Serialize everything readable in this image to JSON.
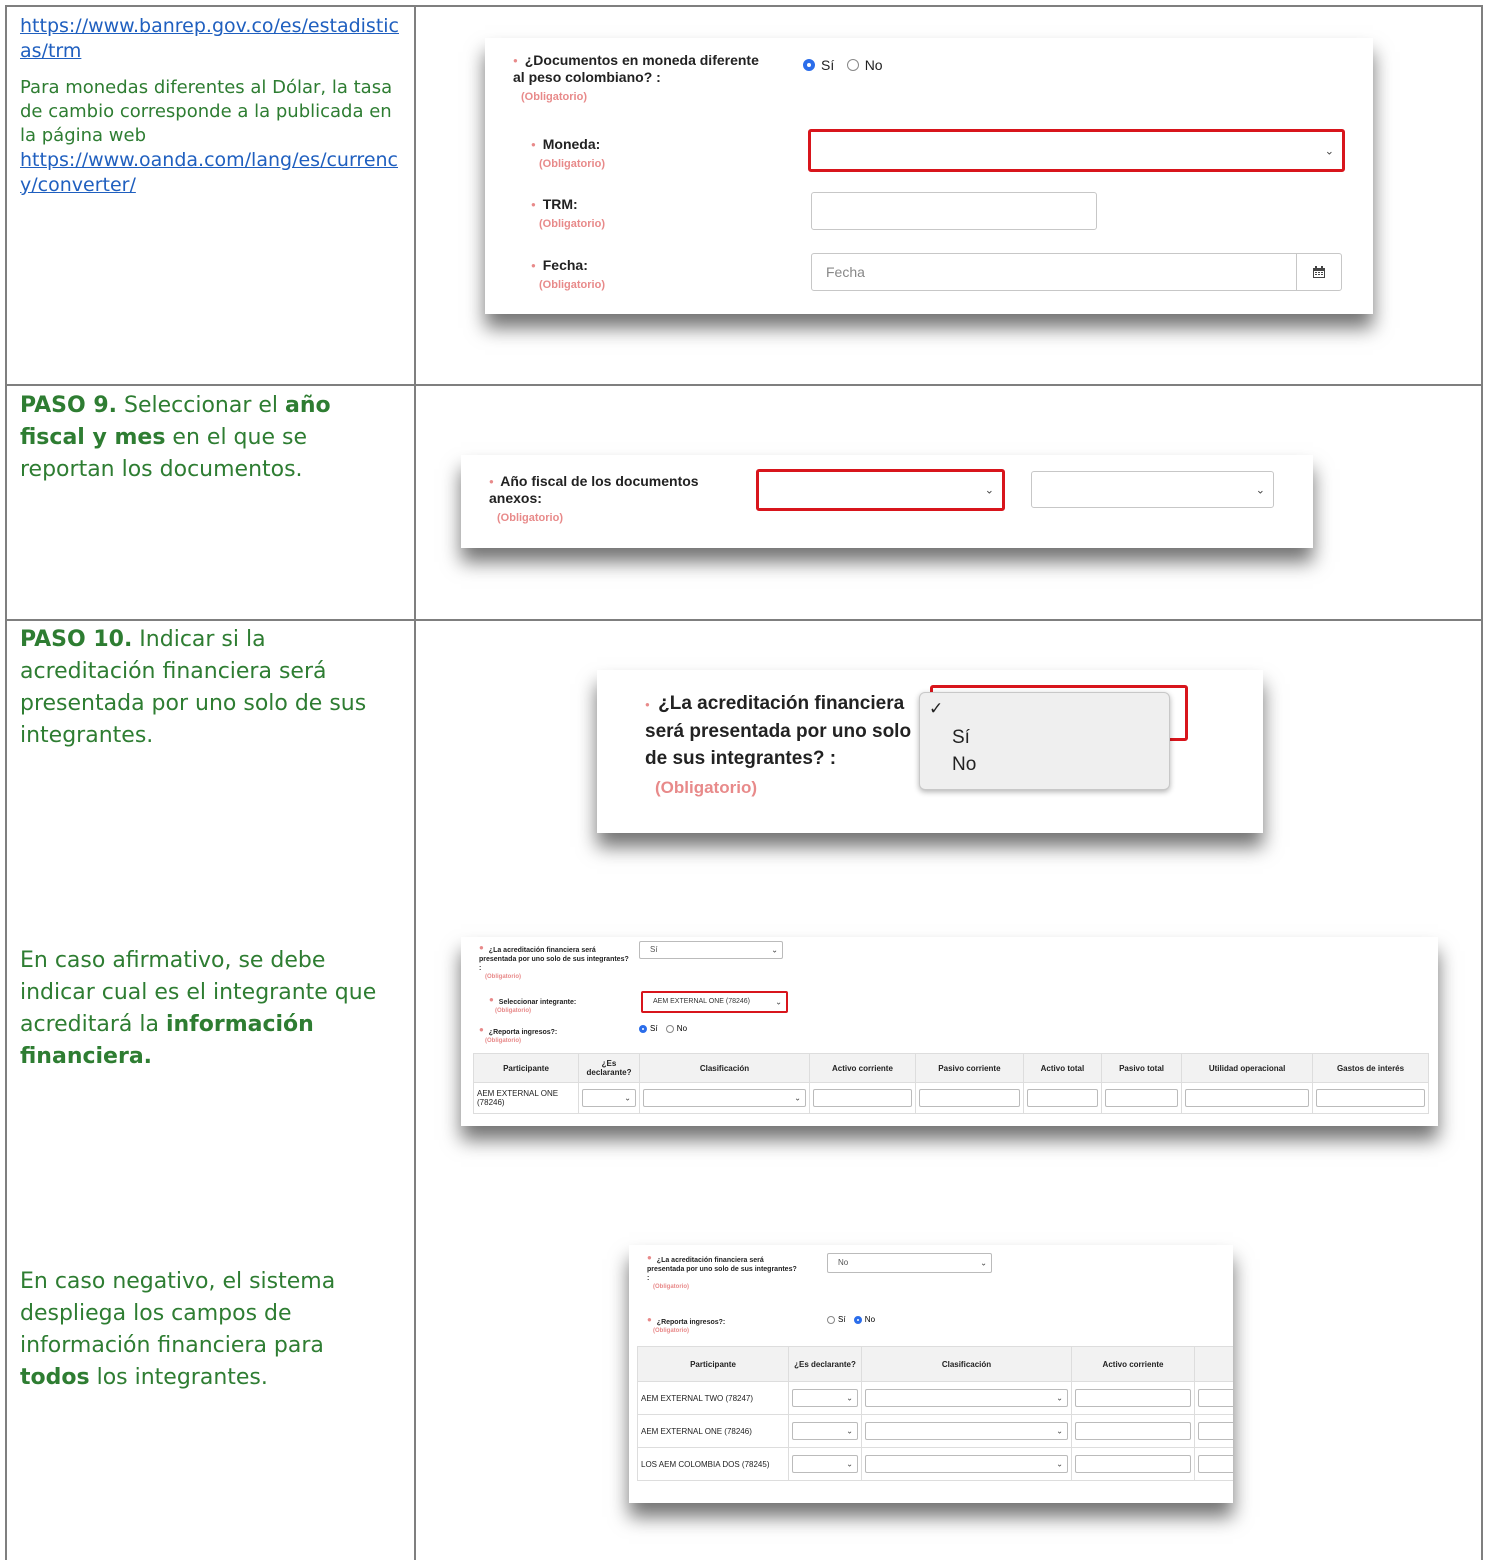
{
  "row1": {
    "link1": "https://www.banrep.gov.co/es/estadisticas/trm",
    "text": "Para monedas diferentes al Dólar, la tasa de cambio corresponde a la publicada en la página web",
    "link2": "https://www.oanda.com/lang/es/currency/converter/",
    "form": {
      "q_docs": "¿Documentos en moneda diferente al peso colombiano? :",
      "required": "(Obligatorio)",
      "opt_si": "Sí",
      "opt_no": "No",
      "moneda": "Moneda:",
      "trm": "TRM:",
      "fecha": "Fecha:",
      "fecha_placeholder": "Fecha"
    }
  },
  "row2": {
    "step": "PASO 9.",
    "t1": " Seleccionar el ",
    "b1": "año fiscal y mes",
    "t2": " en el que se reportan los documentos.",
    "form": {
      "label": "Año fiscal de los documentos anexos:",
      "required": "(Obligatorio)"
    }
  },
  "row3": {
    "step": "PASO 10.",
    "t1": " Indicar si la acreditación financiera será presentada por uno solo de sus integrantes.",
    "dropdown": {
      "label": "¿La acreditación financiera será presentada por uno solo de sus integrantes? :",
      "required": "(Obligatorio)",
      "check": "✓",
      "opt1": "Sí",
      "opt2": "No"
    },
    "affirm_text": "En caso afirmativo, se debe indicar cual es el integrante que acreditará la ",
    "affirm_bold": "información financiera.",
    "affirm_form": {
      "q": "¿La acreditación financiera será presentada por uno solo de sus integrantes? :",
      "required": "(Obligatorio)",
      "value": "Sí",
      "select_label": "Seleccionar integrante:",
      "select_value": "AEM EXTERNAL ONE (78246)",
      "ingresos": "¿Reporta ingresos?:",
      "si": "Sí",
      "no": "No",
      "headers": [
        "Participante",
        "¿Es declarante?",
        "Clasificación",
        "Activo corriente",
        "Pasivo corriente",
        "Activo total",
        "Pasivo total",
        "Utilidad operacional",
        "Gastos de interés"
      ],
      "rows": [
        "AEM EXTERNAL ONE (78246)"
      ]
    },
    "neg_text1": "En caso negativo, el sistema despliega los campos de información financiera para ",
    "neg_bold": "todos",
    "neg_text2": " los integrantes.",
    "neg_form": {
      "q": "¿La acreditación financiera será presentada por uno solo de sus integrantes? :",
      "required": "(Obligatorio)",
      "value": "No",
      "ingresos": "¿Reporta ingresos?:",
      "si": "Sí",
      "no": "No",
      "headers": [
        "Participante",
        "¿Es declarante?",
        "Clasificación",
        "Activo corriente"
      ],
      "rows": [
        "AEM EXTERNAL TWO (78247)",
        "AEM EXTERNAL ONE (78246)",
        "LOS AEM COLOMBIA DOS (78245)"
      ]
    }
  }
}
